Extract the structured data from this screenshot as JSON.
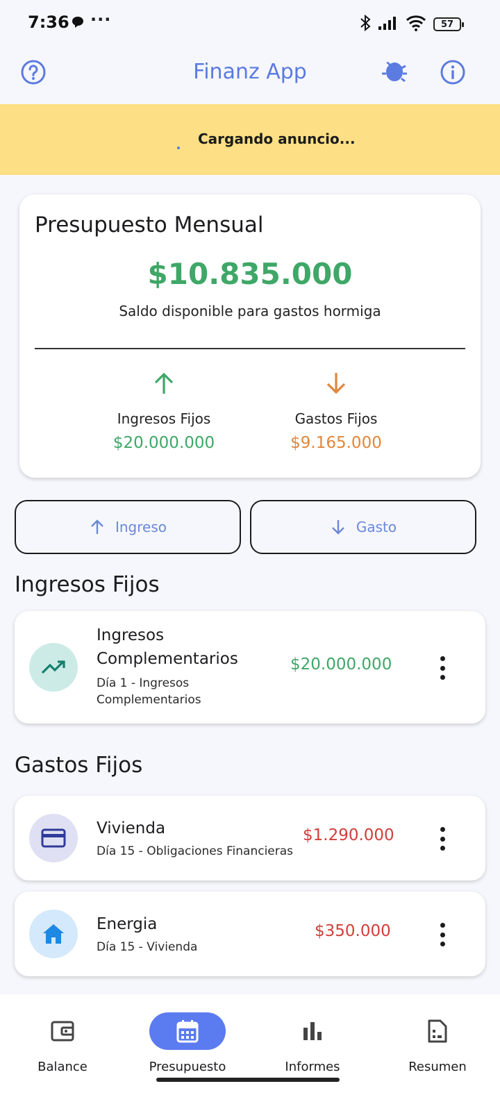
{
  "status_bar": {
    "time": "7:36",
    "more": "···",
    "battery": "57"
  },
  "app_bar": {
    "title": "Finanz App"
  },
  "ad_banner": {
    "text": "Cargando anuncio..."
  },
  "budget": {
    "title": "Presupuesto Mensual",
    "available_amount": "$10.835.000",
    "available_caption": "Saldo disponible para gastos hormiga",
    "fixed_income_label": "Ingresos Fijos",
    "fixed_income_value": "$20.000.000",
    "fixed_expense_label": "Gastos Fijos",
    "fixed_expense_value": "$9.165.000"
  },
  "actions": {
    "income_label": "Ingreso",
    "expense_label": "Gasto"
  },
  "income_section": {
    "title": "Ingresos Fijos",
    "items": [
      {
        "name_line1": "Ingresos",
        "name_line2": "Complementarios",
        "sub_line1": "Día 1 - Ingresos",
        "sub_line2": "Complementarios",
        "amount": "$20.000.000",
        "icon": "trending-up-icon"
      }
    ]
  },
  "expense_section": {
    "title": "Gastos Fijos",
    "items": [
      {
        "name": "Vivienda",
        "sub": "Día 15 - Obligaciones Financieras",
        "amount": "$1.290.000",
        "icon": "credit-card-icon"
      },
      {
        "name": "Energia",
        "sub": "Día 15 - Vivienda",
        "amount": "$350.000",
        "icon": "home-icon"
      }
    ]
  },
  "bottom_nav": {
    "items": [
      {
        "label": "Balance",
        "icon": "wallet-icon"
      },
      {
        "label": "Presupuesto",
        "icon": "calendar-icon",
        "active": true
      },
      {
        "label": "Informes",
        "icon": "bar-chart-icon"
      },
      {
        "label": "Resumen",
        "icon": "document-icon"
      }
    ]
  },
  "colors": {
    "accent": "#5b7be0",
    "ad_background": "#fde085",
    "income_green": "#3fa767",
    "expense_orange": "#e0863a",
    "expense_red": "#cf3f3a"
  }
}
